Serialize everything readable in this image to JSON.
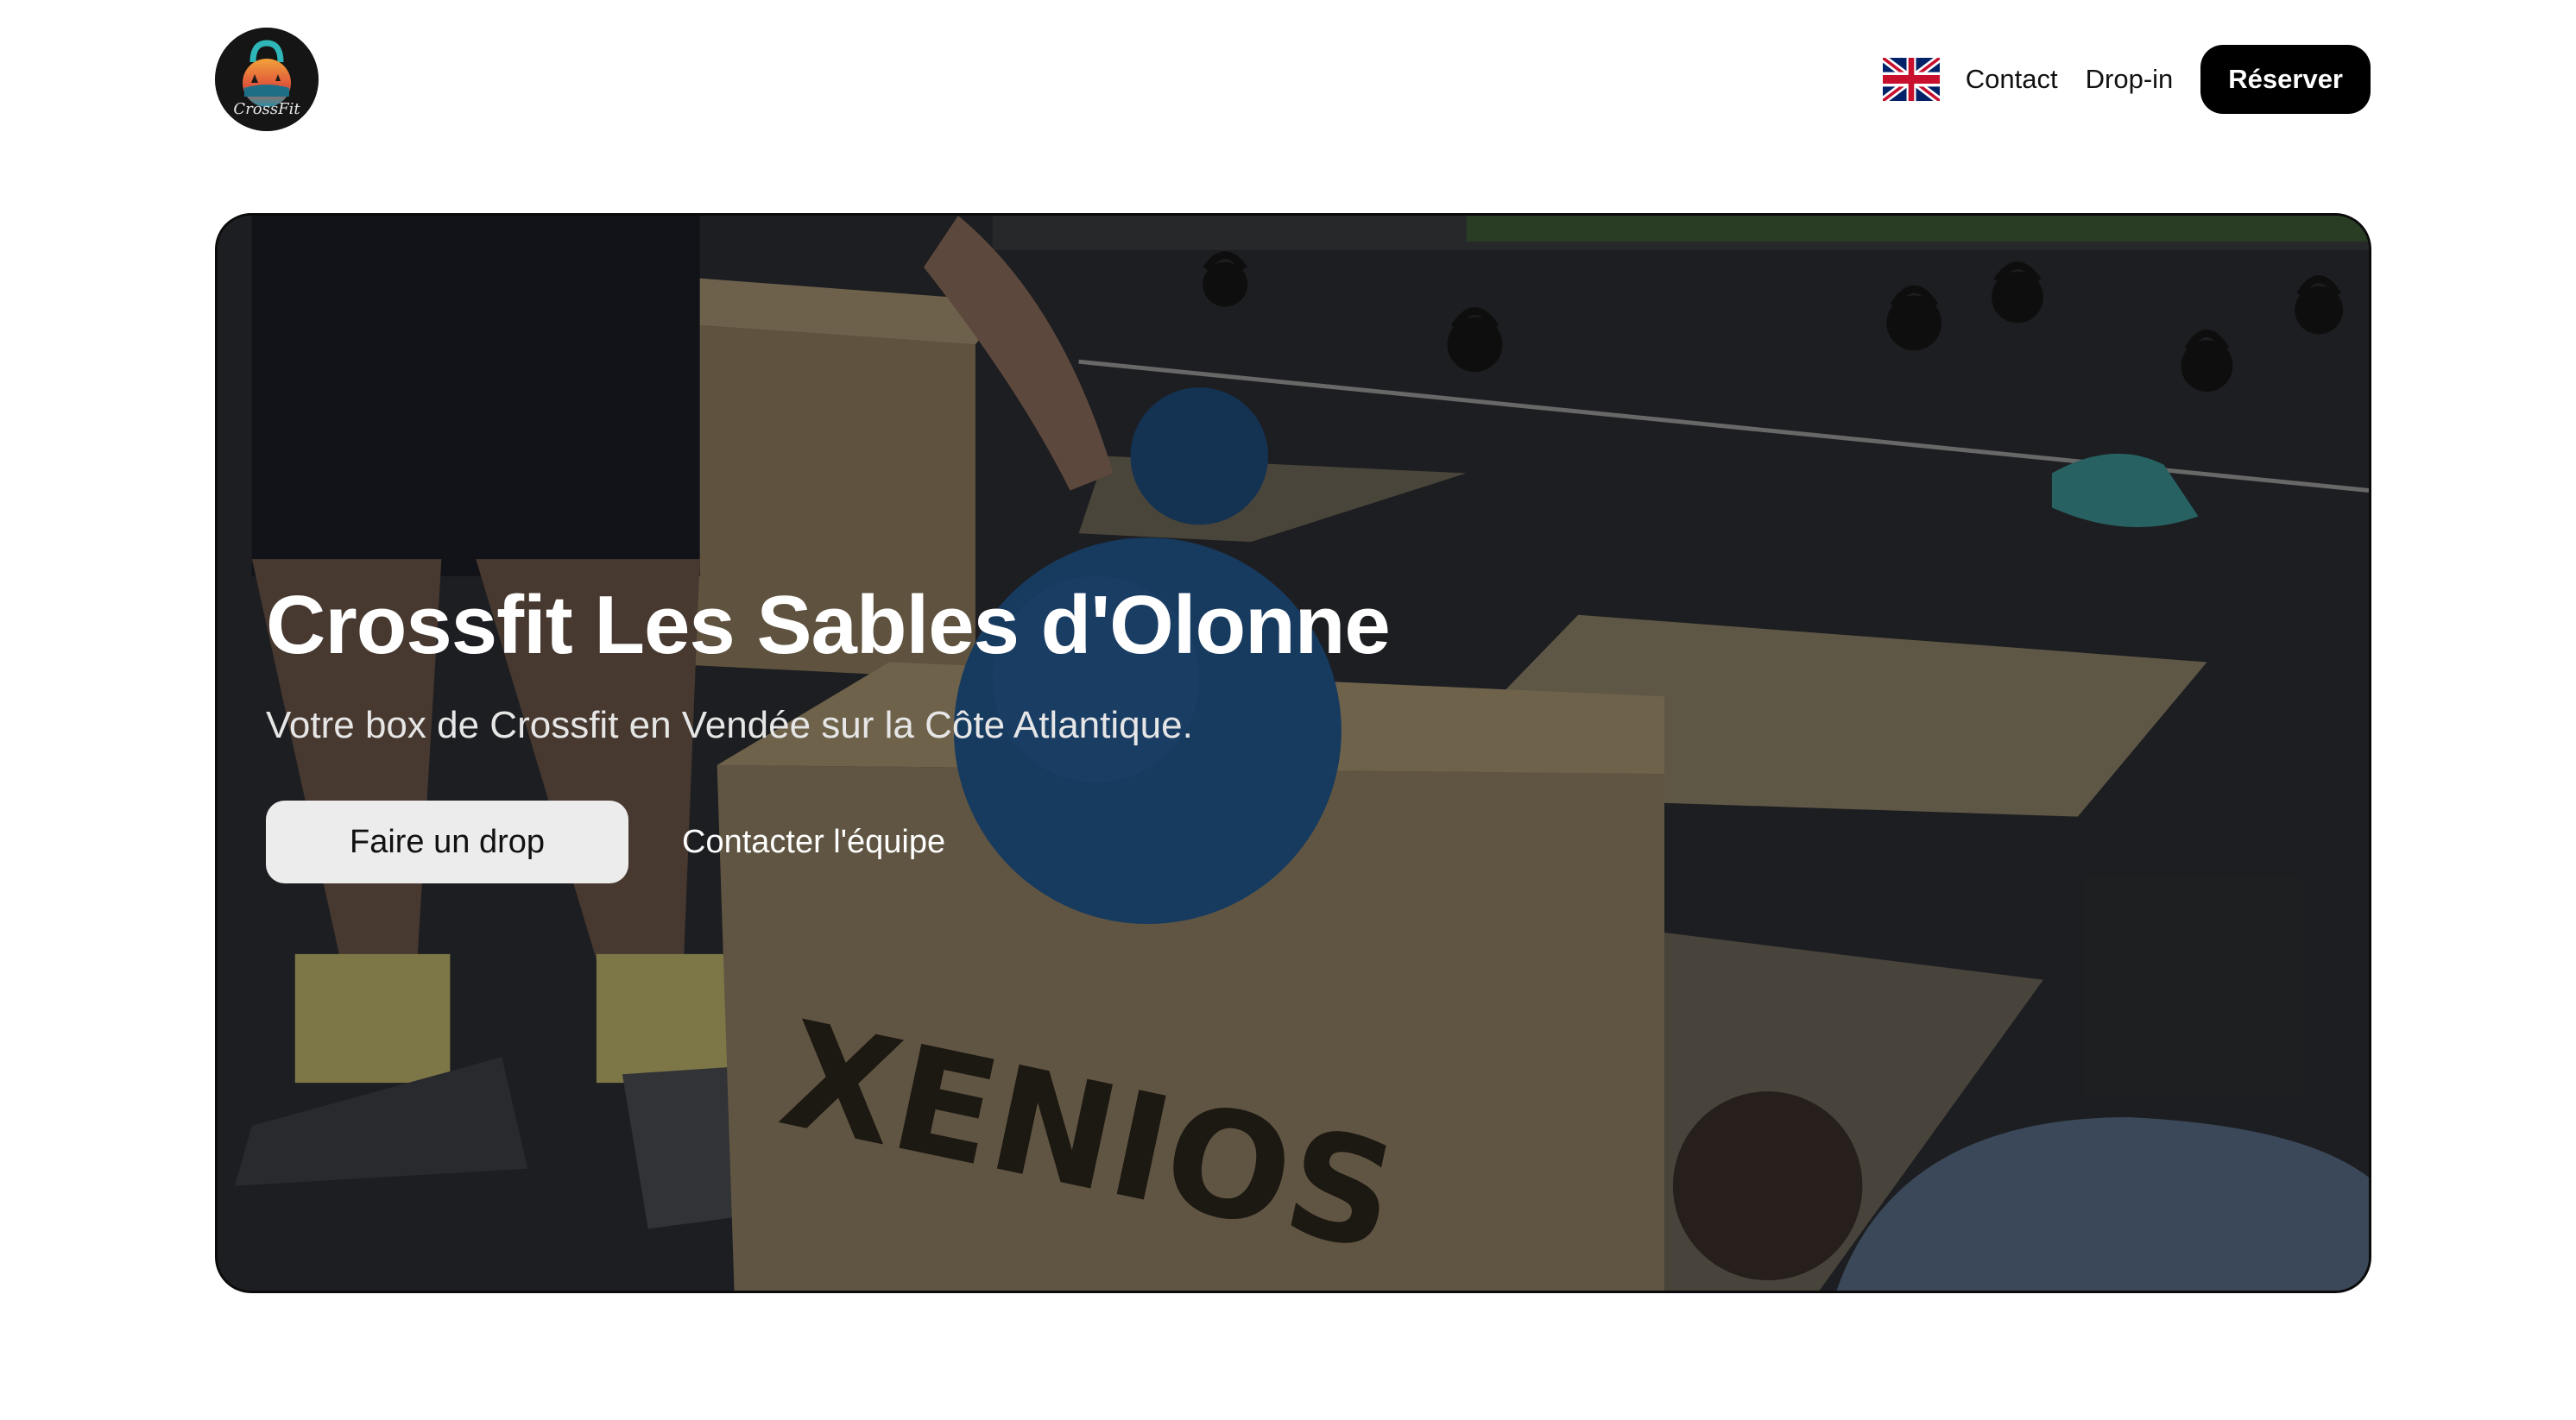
{
  "header": {
    "nav": {
      "contact_label": "Contact",
      "dropin_label": "Drop-in",
      "reserve_label": "Réserver",
      "language_icon": "uk-flag-icon"
    },
    "logo_icon": "kettlebell-crossfit-logo"
  },
  "hero": {
    "title": "Crossfit Les Sables d'Olonne",
    "subtitle": "Votre box de Crossfit en Vendée sur la Côte Atlantique.",
    "primary_button": "Faire un drop",
    "secondary_button": "Contacter l'équipe"
  },
  "colors": {
    "accent": "#000000",
    "page_bg": "#ffffff",
    "hero_text": "#ffffff",
    "primary_button_bg": "#ececec"
  }
}
